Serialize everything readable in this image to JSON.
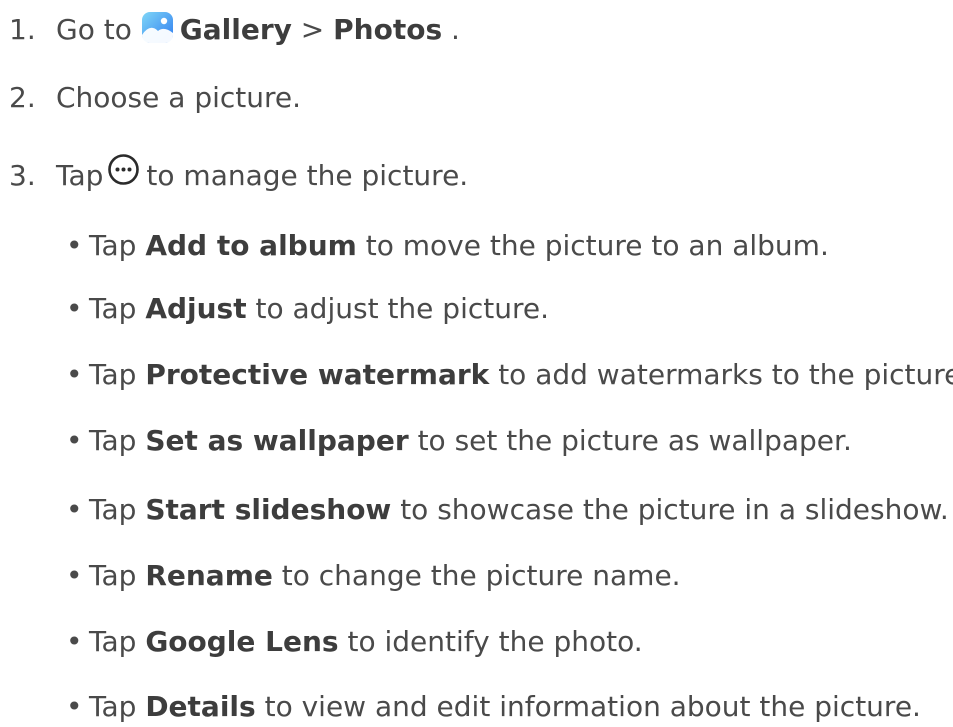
{
  "steps": [
    {
      "number": "1.",
      "prefix": "Go to",
      "gallery": "Gallery",
      "separator": ">",
      "photos": "Photos",
      "suffix": ".",
      "icon": "gallery-app-icon"
    },
    {
      "number": "2.",
      "text": "Choose a picture."
    },
    {
      "number": "3.",
      "prefix": "Tap",
      "suffix": "to manage the picture.",
      "icon": "more-options-icon"
    }
  ],
  "options": [
    {
      "bullet": "•",
      "prefix": "Tap",
      "bold": "Add to album",
      "rest": "to move the picture to an album."
    },
    {
      "bullet": "•",
      "prefix": "Tap",
      "bold": "Adjust",
      "rest": "to adjust the picture."
    },
    {
      "bullet": "•",
      "prefix": "Tap",
      "bold": "Protective watermark",
      "rest": "to add watermarks to the picture."
    },
    {
      "bullet": "•",
      "prefix": "Tap",
      "bold": "Set as wallpaper",
      "rest": "to set the picture as wallpaper."
    },
    {
      "bullet": "•",
      "prefix": "Tap",
      "bold": "Start slideshow",
      "rest": "to showcase the picture in a slideshow."
    },
    {
      "bullet": "•",
      "prefix": "Tap",
      "bold": "Rename",
      "rest": "to change the picture name."
    },
    {
      "bullet": "•",
      "prefix": "Tap",
      "bold": "Google Lens",
      "rest": "to identify the photo."
    },
    {
      "bullet": "•",
      "prefix": "Tap",
      "bold": "Details",
      "rest": "to view and edit information about the picture."
    }
  ],
  "colors": {
    "text": "#4a4a4a",
    "gallery_icon_top": "#5ec8f5",
    "gallery_icon_bottom": "#2f7cf0"
  }
}
